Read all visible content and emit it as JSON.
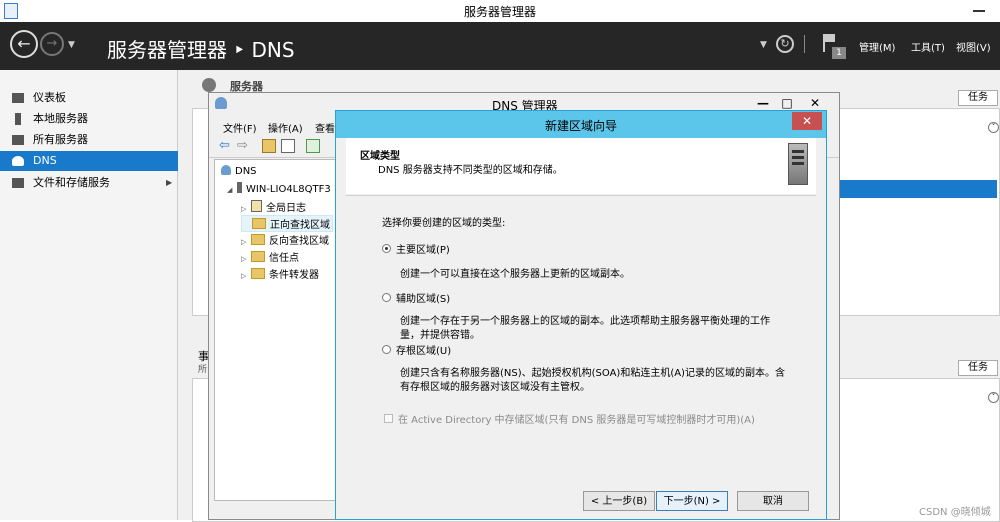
{
  "window": {
    "title": "服务器管理器"
  },
  "header": {
    "title": "服务器管理器 ‣ DNS",
    "menu": [
      "管理(M)",
      "工具(T)",
      "视图(V)"
    ],
    "notification_count": "1"
  },
  "sidebar": {
    "items": [
      {
        "label": "仪表板",
        "icon": "dashboard-icon"
      },
      {
        "label": "本地服务器",
        "icon": "server-icon"
      },
      {
        "label": "所有服务器",
        "icon": "servers-icon"
      },
      {
        "label": "DNS",
        "icon": "dns-icon",
        "selected": true
      },
      {
        "label": "文件和存储服务",
        "icon": "storage-icon",
        "has_children": true
      }
    ]
  },
  "background": {
    "section_title": "服务器",
    "task_label": "任务",
    "event_label": "事",
    "event_sub": "所"
  },
  "dns_manager": {
    "title": "DNS 管理器",
    "menu": [
      "文件(F)",
      "操作(A)",
      "查看"
    ],
    "tree": [
      {
        "label": "DNS",
        "level": 0
      },
      {
        "label": "WIN-LIO4L8QTF3",
        "level": 1
      },
      {
        "label": "全局日志",
        "level": 2
      },
      {
        "label": "正向查找区域",
        "level": 2,
        "selected": true
      },
      {
        "label": "反向查找区域",
        "level": 2
      },
      {
        "label": "信任点",
        "level": 2
      },
      {
        "label": "条件转发器",
        "level": 2
      }
    ]
  },
  "wizard": {
    "title": "新建区域向导",
    "header_title": "区域类型",
    "header_desc": "DNS 服务器支持不同类型的区域和存储。",
    "prompt": "选择你要创建的区域的类型:",
    "options": [
      {
        "label": "主要区域(P)",
        "desc": "创建一个可以直接在这个服务器上更新的区域副本。",
        "selected": true
      },
      {
        "label": "辅助区域(S)",
        "desc": "创建一个存在于另一个服务器上的区域的副本。此选项帮助主服务器平衡处理的工作",
        "desc2": "量，并提供容错。",
        "selected": false
      },
      {
        "label": "存根区域(U)",
        "desc": "创建只含有名称服务器(NS)、起始授权机构(SOA)和粘连主机(A)记录的区域的副本。含",
        "desc2": "有存根区域的服务器对该区域没有主管权。",
        "selected": false
      }
    ],
    "ad_checkbox": "在 Active Directory 中存储区域(只有 DNS 服务器是可写域控制器时才可用)(A)",
    "buttons": {
      "back": "< 上一步(B)",
      "next": "下一步(N) >",
      "cancel": "取消"
    }
  },
  "watermark": "CSDN @晓倾城"
}
